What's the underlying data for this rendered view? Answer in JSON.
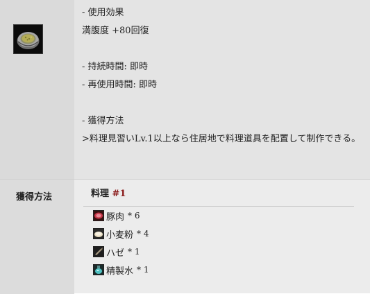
{
  "description": {
    "lines": [
      "- 使用効果",
      "満腹度 +80回復",
      "",
      "- 持続時間: 即時",
      "- 再使用時間: 即時",
      "",
      "- 獲得方法",
      ">料理見習いLv.1以上なら住居地で料理道具を配置して制作できる。"
    ]
  },
  "acquire": {
    "header": "獲得方法",
    "recipe_title": "料理",
    "recipe_number": "#1",
    "ingredients": [
      {
        "name": "豚肉",
        "qty": "* 6",
        "icon": "pork-icon"
      },
      {
        "name": "小麦粉",
        "qty": "* 4",
        "icon": "flour-icon"
      },
      {
        "name": "ハゼ",
        "qty": "* 1",
        "icon": "goby-fish-icon"
      },
      {
        "name": "精製水",
        "qty": "* 1",
        "icon": "purified-water-icon"
      }
    ]
  },
  "item_icon": "food-bowl-icon"
}
